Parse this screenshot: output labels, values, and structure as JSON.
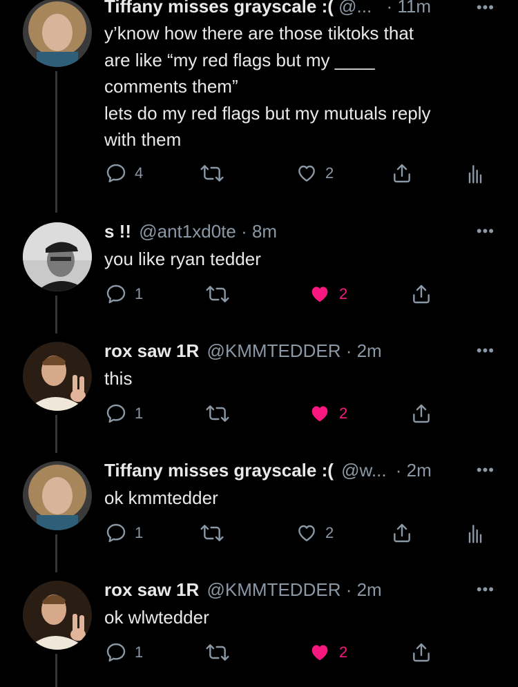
{
  "colors": {
    "background": "#000000",
    "text": "#e7e9ea",
    "muted": "#8b98a5",
    "like": "#f91880",
    "thread_line": "#333639"
  },
  "tweets": [
    {
      "name": "Tiffany misses grayscale :(",
      "handle": "@...",
      "time": "· 11m",
      "text_lines": [
        "y’know how there are those tiktoks that",
        "are like “my red flags but my ____",
        "comments them”",
        "lets do my red flags but my mutuals reply",
        "with them"
      ],
      "replies": "4",
      "likes": "2",
      "liked": false,
      "has_analytics": true,
      "avatar_icon": "avatar-curly-hair"
    },
    {
      "name": "s !!",
      "handle": "@ant1xd0te",
      "time": "· 8m",
      "text_lines": [
        "you like ryan tedder"
      ],
      "replies": "1",
      "likes": "2",
      "liked": true,
      "has_analytics": false,
      "avatar_icon": "avatar-cap-glasses-bw"
    },
    {
      "name": "rox saw 1R",
      "handle": "@KMMTEDDER",
      "time": "· 2m",
      "text_lines": [
        "this"
      ],
      "replies": "1",
      "likes": "2",
      "liked": true,
      "has_analytics": false,
      "avatar_icon": "avatar-peace-sign"
    },
    {
      "name": "Tiffany misses grayscale :(",
      "handle": "@w...",
      "time": "· 2m",
      "text_lines": [
        "ok kmmtedder"
      ],
      "replies": "1",
      "likes": "2",
      "liked": false,
      "has_analytics": true,
      "avatar_icon": "avatar-curly-hair"
    },
    {
      "name": "rox saw 1R",
      "handle": "@KMMTEDDER",
      "time": "· 2m",
      "text_lines": [
        "ok wlwtedder"
      ],
      "replies": "1",
      "likes": "2",
      "liked": true,
      "has_analytics": false,
      "avatar_icon": "avatar-peace-sign"
    }
  ],
  "more_label": "•••"
}
